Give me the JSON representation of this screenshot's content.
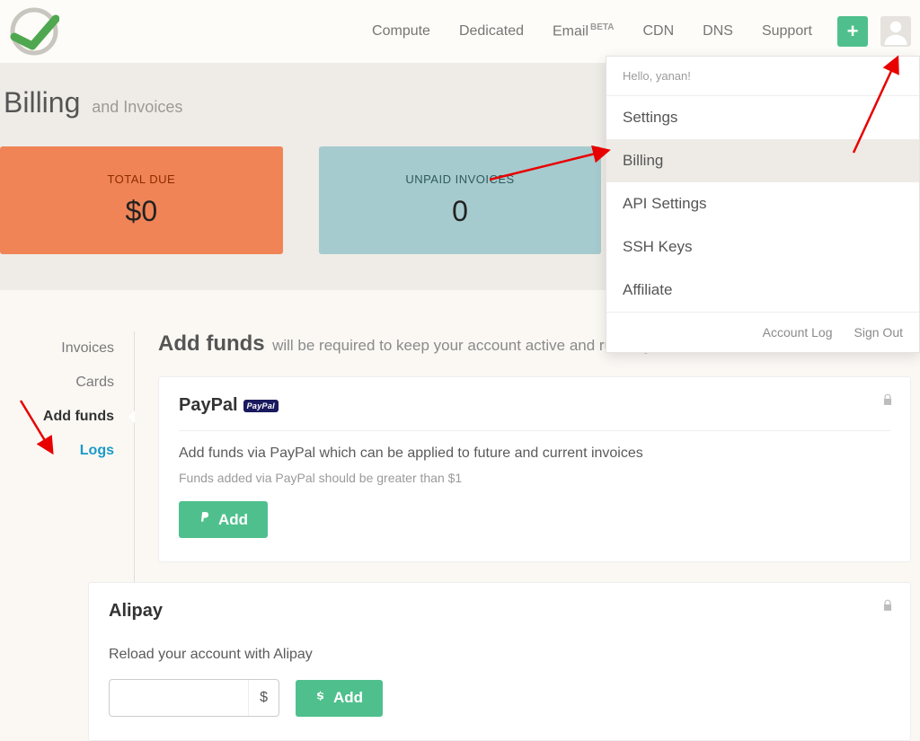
{
  "nav": {
    "items": [
      "Compute",
      "Dedicated",
      "Email",
      "CDN",
      "DNS",
      "Support"
    ],
    "email_badge": "BETA"
  },
  "dropdown": {
    "hello": "Hello, yanan!",
    "items": [
      "Settings",
      "Billing",
      "API Settings",
      "SSH Keys",
      "Affiliate"
    ],
    "footer": [
      "Account Log",
      "Sign Out"
    ]
  },
  "hero": {
    "title": "Billing",
    "subtitle": "and Invoices",
    "cards": [
      {
        "label": "TOTAL DUE",
        "value": "$0"
      },
      {
        "label": "UNPAID INVOICES",
        "value": "0"
      }
    ]
  },
  "sidebar": {
    "items": [
      "Invoices",
      "Cards",
      "Add funds",
      "Logs"
    ]
  },
  "main": {
    "heading": "Add funds",
    "heading_sub": "will be required to keep your account active and running",
    "paypal": {
      "title": "PayPal",
      "badge": "PayPal",
      "desc": "Add funds via PayPal which can be applied to future and current invoices",
      "note": "Funds added via PayPal should be greater than $1",
      "button": "Add"
    },
    "alipay": {
      "title": "Alipay",
      "desc": "Reload your account with Alipay",
      "currency": "$",
      "button": "Add"
    }
  }
}
